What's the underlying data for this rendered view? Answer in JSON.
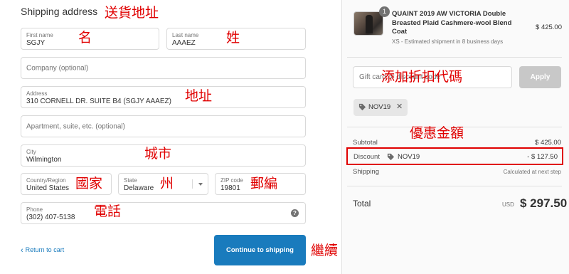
{
  "form": {
    "section_title": "Shipping address",
    "first_name": {
      "label": "First name",
      "value": "SGJY"
    },
    "last_name": {
      "label": "Last name",
      "value": "AAAEZ"
    },
    "company": {
      "placeholder": "Company (optional)"
    },
    "address": {
      "label": "Address",
      "value": "310 CORNELL DR. SUITE B4  (SGJY AAAEZ)"
    },
    "apartment": {
      "placeholder": "Apartment, suite, etc. (optional)"
    },
    "city": {
      "label": "City",
      "value": "Wilmington"
    },
    "country": {
      "label": "Country/Region",
      "value": "United States"
    },
    "state": {
      "label": "State",
      "value": "Delaware"
    },
    "zip": {
      "label": "ZIP code",
      "value": "19801"
    },
    "phone": {
      "label": "Phone",
      "value": "(302) 407-5138",
      "help_icon": "?"
    },
    "return_link": "Return to cart",
    "return_chevron": "‹",
    "continue_button": "Continue to shipping"
  },
  "annotations": {
    "address_header": "送貨地址",
    "first_name": "名",
    "last_name": "姓",
    "address": "地址",
    "city": "城市",
    "country": "國家",
    "state": "州",
    "zip": "郵編",
    "phone": "電話",
    "continue": "繼續",
    "gift_card": "添加折扣代碼",
    "discount": "優惠金額",
    "color": "#e00000"
  },
  "summary": {
    "item": {
      "quantity_badge": "1",
      "name": "QUAINT 2019 AW VICTORIA Double Breasted Plaid Cashmere-wool Blend Coat",
      "meta": "XS - Estimated shipment in 8 business days",
      "price": "$ 425.00"
    },
    "gift_card": {
      "placeholder": "Gift card or discount code",
      "apply_label": "Apply"
    },
    "applied_code": {
      "code": "NOV19",
      "remove_icon": "✕"
    },
    "subtotal": {
      "label": "Subtotal",
      "value": "$ 425.00"
    },
    "discount": {
      "label": "Discount",
      "code": "NOV19",
      "value": "- $ 127.50"
    },
    "shipping": {
      "label": "Shipping",
      "value": "Calculated at next step"
    },
    "total": {
      "label": "Total",
      "currency": "USD",
      "value": "$ 297.50"
    }
  },
  "colors": {
    "accent": "#197bbd",
    "highlight": "#e00000",
    "apply_disabled": "#c8c8c8"
  }
}
